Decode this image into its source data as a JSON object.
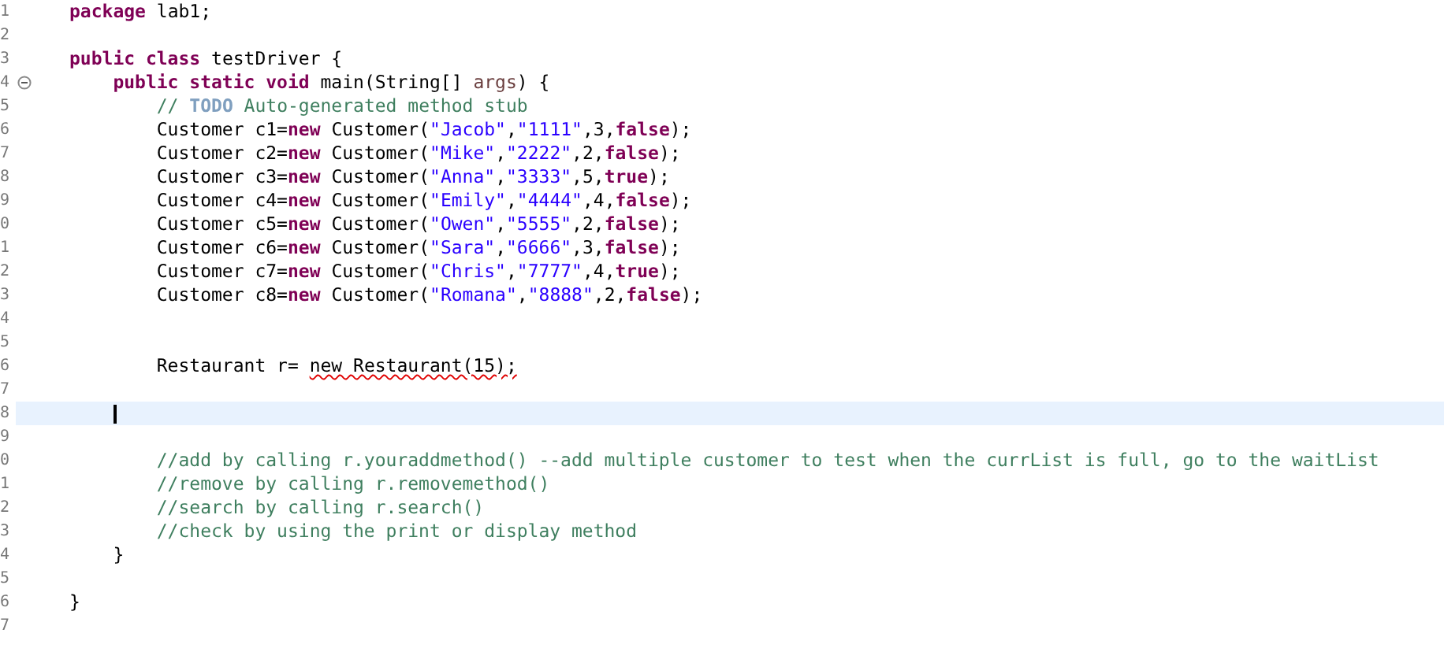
{
  "editor": {
    "lines": [
      {
        "number": "1",
        "current": false,
        "fold": false,
        "tokens": [
          {
            "kind": "keyword",
            "text": "package"
          },
          {
            "kind": "plain",
            "text": " lab1;"
          }
        ]
      },
      {
        "number": "2",
        "current": false,
        "fold": false
      },
      {
        "number": "3",
        "current": false,
        "fold": false,
        "tokens": [
          {
            "kind": "keyword",
            "text": "public class"
          },
          {
            "kind": "plain",
            "text": " testDriver {"
          }
        ]
      },
      {
        "number": "4",
        "current": false,
        "fold": true,
        "tokens": [
          {
            "kind": "keyword",
            "text": "    public static void"
          },
          {
            "kind": "plain",
            "text": " main(String[] "
          },
          {
            "kind": "variable",
            "text": "args"
          },
          {
            "kind": "plain",
            "text": ") {"
          }
        ]
      },
      {
        "number": "5",
        "current": false,
        "fold": false,
        "tokens": [
          {
            "kind": "comment",
            "text": "        // "
          },
          {
            "kind": "todo",
            "text": "TODO"
          },
          {
            "kind": "comment",
            "text": " Auto-generated method stub"
          }
        ]
      },
      {
        "number": "6",
        "current": false,
        "fold": false,
        "tokens": [
          {
            "kind": "plain",
            "text": "        Customer c1="
          },
          {
            "kind": "keyword",
            "text": "new"
          },
          {
            "kind": "plain",
            "text": " Customer("
          },
          {
            "kind": "string",
            "text": "\"Jacob\""
          },
          {
            "kind": "plain",
            "text": ","
          },
          {
            "kind": "string",
            "text": "\"1111\""
          },
          {
            "kind": "plain",
            "text": ",3,"
          },
          {
            "kind": "keyword",
            "text": "false"
          },
          {
            "kind": "plain",
            "text": ");"
          }
        ]
      },
      {
        "number": "7",
        "current": false,
        "fold": false,
        "tokens": [
          {
            "kind": "plain",
            "text": "        Customer c2="
          },
          {
            "kind": "keyword",
            "text": "new"
          },
          {
            "kind": "plain",
            "text": " Customer("
          },
          {
            "kind": "string",
            "text": "\"Mike\""
          },
          {
            "kind": "plain",
            "text": ","
          },
          {
            "kind": "string",
            "text": "\"2222\""
          },
          {
            "kind": "plain",
            "text": ",2,"
          },
          {
            "kind": "keyword",
            "text": "false"
          },
          {
            "kind": "plain",
            "text": ");"
          }
        ]
      },
      {
        "number": "8",
        "current": false,
        "fold": false,
        "tokens": [
          {
            "kind": "plain",
            "text": "        Customer c3="
          },
          {
            "kind": "keyword",
            "text": "new"
          },
          {
            "kind": "plain",
            "text": " Customer("
          },
          {
            "kind": "string",
            "text": "\"Anna\""
          },
          {
            "kind": "plain",
            "text": ","
          },
          {
            "kind": "string",
            "text": "\"3333\""
          },
          {
            "kind": "plain",
            "text": ",5,"
          },
          {
            "kind": "keyword",
            "text": "true"
          },
          {
            "kind": "plain",
            "text": ");"
          }
        ]
      },
      {
        "number": "9",
        "current": false,
        "fold": false,
        "tokens": [
          {
            "kind": "plain",
            "text": "        Customer c4="
          },
          {
            "kind": "keyword",
            "text": "new"
          },
          {
            "kind": "plain",
            "text": " Customer("
          },
          {
            "kind": "string",
            "text": "\"Emily\""
          },
          {
            "kind": "plain",
            "text": ","
          },
          {
            "kind": "string",
            "text": "\"4444\""
          },
          {
            "kind": "plain",
            "text": ",4,"
          },
          {
            "kind": "keyword",
            "text": "false"
          },
          {
            "kind": "plain",
            "text": ");"
          }
        ]
      },
      {
        "number": "0",
        "current": false,
        "fold": false,
        "tokens": [
          {
            "kind": "plain",
            "text": "        Customer c5="
          },
          {
            "kind": "keyword",
            "text": "new"
          },
          {
            "kind": "plain",
            "text": " Customer("
          },
          {
            "kind": "string",
            "text": "\"Owen\""
          },
          {
            "kind": "plain",
            "text": ","
          },
          {
            "kind": "string",
            "text": "\"5555\""
          },
          {
            "kind": "plain",
            "text": ",2,"
          },
          {
            "kind": "keyword",
            "text": "false"
          },
          {
            "kind": "plain",
            "text": ");"
          }
        ]
      },
      {
        "number": "1",
        "current": false,
        "fold": false,
        "tokens": [
          {
            "kind": "plain",
            "text": "        Customer c6="
          },
          {
            "kind": "keyword",
            "text": "new"
          },
          {
            "kind": "plain",
            "text": " Customer("
          },
          {
            "kind": "string",
            "text": "\"Sara\""
          },
          {
            "kind": "plain",
            "text": ","
          },
          {
            "kind": "string",
            "text": "\"6666\""
          },
          {
            "kind": "plain",
            "text": ",3,"
          },
          {
            "kind": "keyword",
            "text": "false"
          },
          {
            "kind": "plain",
            "text": ");"
          }
        ]
      },
      {
        "number": "2",
        "current": false,
        "fold": false,
        "tokens": [
          {
            "kind": "plain",
            "text": "        Customer c7="
          },
          {
            "kind": "keyword",
            "text": "new"
          },
          {
            "kind": "plain",
            "text": " Customer("
          },
          {
            "kind": "string",
            "text": "\"Chris\""
          },
          {
            "kind": "plain",
            "text": ","
          },
          {
            "kind": "string",
            "text": "\"7777\""
          },
          {
            "kind": "plain",
            "text": ",4,"
          },
          {
            "kind": "keyword",
            "text": "true"
          },
          {
            "kind": "plain",
            "text": ");"
          }
        ]
      },
      {
        "number": "3",
        "current": false,
        "fold": false,
        "tokens": [
          {
            "kind": "plain",
            "text": "        Customer c8="
          },
          {
            "kind": "keyword",
            "text": "new"
          },
          {
            "kind": "plain",
            "text": " Customer("
          },
          {
            "kind": "string",
            "text": "\"Romana\""
          },
          {
            "kind": "plain",
            "text": ","
          },
          {
            "kind": "string",
            "text": "\"8888\""
          },
          {
            "kind": "plain",
            "text": ",2,"
          },
          {
            "kind": "keyword",
            "text": "false"
          },
          {
            "kind": "plain",
            "text": ");"
          }
        ]
      },
      {
        "number": "4",
        "current": false,
        "fold": false
      },
      {
        "number": "5",
        "current": false,
        "fold": false
      },
      {
        "number": "6",
        "current": false,
        "fold": false,
        "tokens": [
          {
            "kind": "plain",
            "text": "        Restaurant r= "
          },
          {
            "kind": "error",
            "text": "new Restaurant(15);"
          }
        ]
      },
      {
        "number": "7",
        "current": false,
        "fold": false
      },
      {
        "number": "8",
        "current": true,
        "fold": false
      },
      {
        "number": "9",
        "current": false,
        "fold": false
      },
      {
        "number": "0",
        "current": false,
        "fold": false,
        "tokens": [
          {
            "kind": "comment",
            "text": "        //add by calling r.youraddmethod() --add multiple customer to test when the currList is full, go to the waitList"
          }
        ]
      },
      {
        "number": "1",
        "current": false,
        "fold": false,
        "tokens": [
          {
            "kind": "comment",
            "text": "        //remove by calling r.removemethod()"
          }
        ]
      },
      {
        "number": "2",
        "current": false,
        "fold": false,
        "tokens": [
          {
            "kind": "comment",
            "text": "        //search by calling r.search()"
          }
        ]
      },
      {
        "number": "3",
        "current": false,
        "fold": false,
        "tokens": [
          {
            "kind": "comment",
            "text": "        //check by using the print or display method"
          }
        ]
      },
      {
        "number": "4",
        "current": false,
        "fold": false,
        "tokens": [
          {
            "kind": "plain",
            "text": "    }"
          }
        ]
      },
      {
        "number": "5",
        "current": false,
        "fold": false
      },
      {
        "number": "6",
        "current": false,
        "fold": false,
        "tokens": [
          {
            "kind": "plain",
            "text": "}"
          }
        ]
      },
      {
        "number": "7",
        "current": false,
        "fold": false
      }
    ]
  }
}
